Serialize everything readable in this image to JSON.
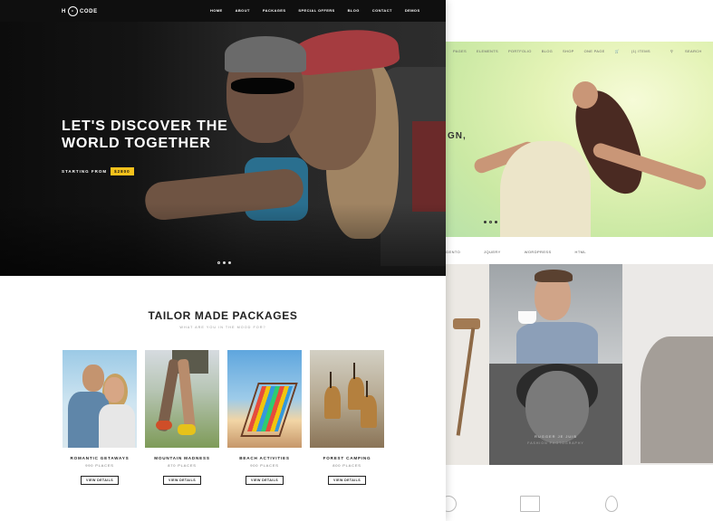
{
  "front": {
    "logo": {
      "circle": "H",
      "text": "CODE",
      "prefix": "H"
    },
    "nav": [
      "HOME",
      "ABOUT",
      "PACKAGES",
      "SPECIAL OFFERS",
      "BLOG",
      "CONTACT",
      "DEMOS"
    ],
    "hero": {
      "title_line1": "LET'S DISCOVER THE",
      "title_line2": "WORLD TOGETHER",
      "starting_label": "STARTING FROM",
      "price": "$2800"
    },
    "section": {
      "title": "TAILOR MADE PACKAGES",
      "subtitle": "WHAT ARE YOU IN THE MOOD FOR?"
    },
    "packages": [
      {
        "name": "ROMANTIC GETAWAYS",
        "places": "990 PLACES",
        "button": "VIEW DETAILS"
      },
      {
        "name": "MOUNTAIN MADNESS",
        "places": "870 PLACES",
        "button": "VIEW DETAILS"
      },
      {
        "name": "BEACH ACTIVITIES",
        "places": "900 PLACES",
        "button": "VIEW DETAILS"
      },
      {
        "name": "FOREST CAMPING",
        "places": "800 PLACES",
        "button": "VIEW DETAILS"
      }
    ],
    "colors": {
      "price_badge": "#f6c21c",
      "nav_bg": "#0f0f0f"
    }
  },
  "back": {
    "nav": [
      "PAGES",
      "ELEMENTS",
      "PORTFOLIO",
      "BLOG",
      "SHOP",
      "ONE PAGE"
    ],
    "cart": "(1) ITEMS",
    "search": "SEARCH",
    "hero_text": "GN,",
    "tags": [
      "GENTO",
      "JQUERY",
      "WORDPRESS",
      "HTML"
    ],
    "caption_title": "RUGGER JE JUIB",
    "caption_sub": "FASHION PHOTOGRAPHY"
  }
}
